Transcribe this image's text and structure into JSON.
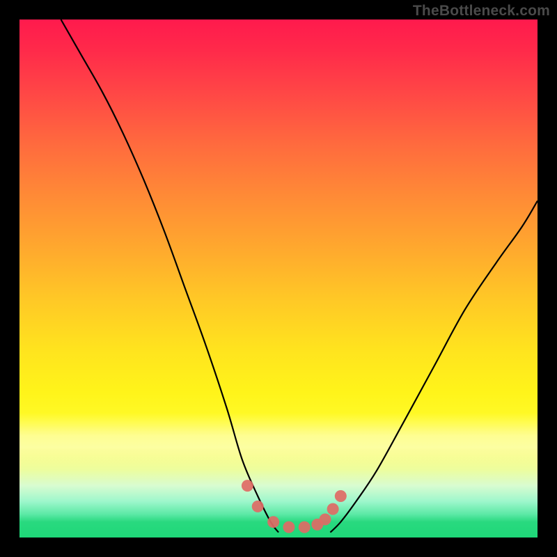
{
  "watermark": "TheBottleneck.com",
  "chart_data": {
    "type": "line",
    "title": "",
    "xlabel": "",
    "ylabel": "",
    "xlim": [
      0,
      100
    ],
    "ylim": [
      0,
      100
    ],
    "series": [
      {
        "name": "left-curve",
        "x": [
          8,
          12,
          16,
          20,
          24,
          28,
          32,
          36,
          40,
          43,
          46,
          48.5,
          50
        ],
        "values": [
          100,
          93,
          86,
          78,
          69,
          59,
          48,
          37,
          25,
          15,
          8,
          3,
          1
        ]
      },
      {
        "name": "right-curve",
        "x": [
          60,
          62,
          65,
          69,
          74,
          80,
          86,
          92,
          97,
          100
        ],
        "values": [
          1,
          3,
          7,
          13,
          22,
          33,
          44,
          53,
          60,
          65
        ]
      },
      {
        "name": "basin-dots",
        "x": [
          44,
          46,
          49,
          52,
          55,
          57.5,
          59,
          60.5,
          62
        ],
        "values": [
          10,
          6,
          3,
          2,
          2,
          2.5,
          3.5,
          5.5,
          8
        ]
      }
    ],
    "annotations": [],
    "legend": [],
    "colors": {
      "curve": "#000000",
      "dots": "#e06a65",
      "gradient_top": "#ff1a4d",
      "gradient_bottom": "#1ed878"
    }
  }
}
